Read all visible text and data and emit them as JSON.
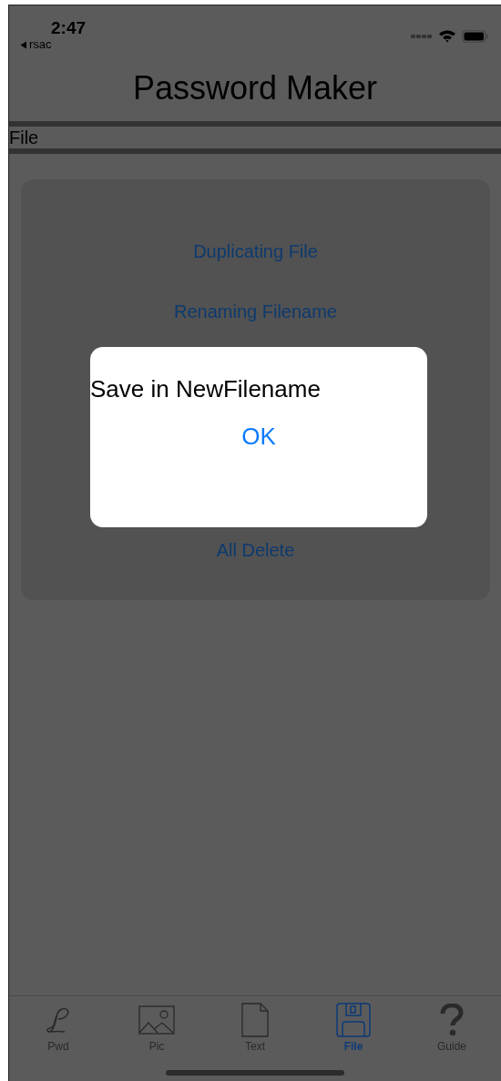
{
  "status_bar": {
    "time": "2:47",
    "back_label": "rsac"
  },
  "title": "Password Maker",
  "section_label": "File",
  "menu_items": [
    "Duplicating File",
    "Renaming Filename",
    "All Delete"
  ],
  "alert": {
    "message": "Save in NewFilename",
    "button": "OK"
  },
  "tabs": [
    {
      "label": "Pwd",
      "kind": "script",
      "selected": false
    },
    {
      "label": "Pic",
      "kind": "picture",
      "selected": false
    },
    {
      "label": "Text",
      "kind": "document",
      "selected": false
    },
    {
      "label": "File",
      "kind": "disk",
      "selected": true
    },
    {
      "label": "Guide",
      "kind": "question",
      "selected": false
    }
  ]
}
